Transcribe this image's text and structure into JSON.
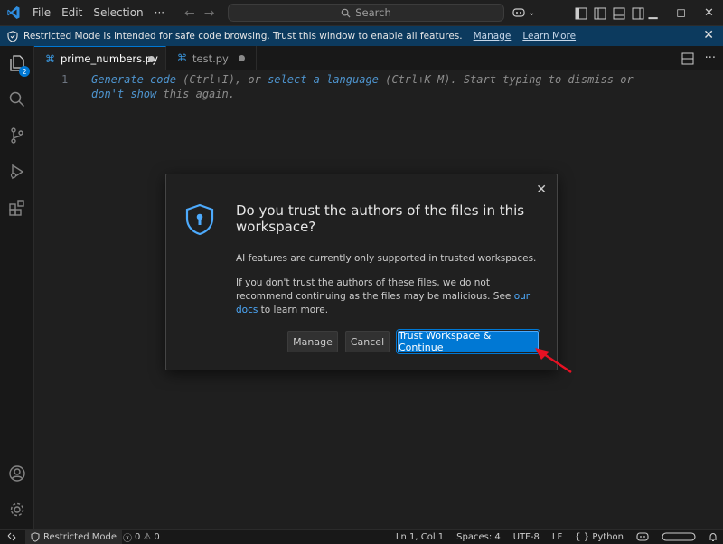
{
  "menu": {
    "file": "File",
    "edit": "Edit",
    "selection": "Selection",
    "more": "···"
  },
  "search": {
    "label": "Search"
  },
  "banner": {
    "message": "Restricted Mode is intended for safe code browsing. Trust this window to enable all features.",
    "manage_link": "Manage",
    "learn_more_link": "Learn More"
  },
  "activity": {
    "source_control_badge": "2"
  },
  "tabs": [
    {
      "label": "prime_numbers.py",
      "active": true,
      "dirty": true
    },
    {
      "label": "test.py",
      "active": false,
      "dirty": true
    }
  ],
  "editor": {
    "line_number": "1",
    "hint": {
      "generate": "Generate code",
      "generate_key": " (Ctrl+I), or ",
      "select_language": "select a language",
      "select_key": " (Ctrl+K M). Start typing to dismiss or",
      "dont_show": "don't show",
      "tail": " this again."
    }
  },
  "dialog": {
    "title": "Do you trust the authors of the files in this workspace?",
    "line1": "AI features are currently only supported in trusted workspaces.",
    "line2_pre": "If you don't trust the authors of these files, we do not recommend continuing as the files may be malicious. See ",
    "line2_link": "our docs",
    "line2_post": " to learn more.",
    "manage_button": "Manage",
    "cancel_button": "Cancel",
    "trust_button": "Trust Workspace & Continue"
  },
  "statusbar": {
    "restricted_mode": "Restricted Mode",
    "errors": "0",
    "warnings": "0",
    "position": "Ln 1, Col 1",
    "spaces": "Spaces: 4",
    "encoding": "UTF-8",
    "eol": "LF",
    "language_braces": "{ }",
    "language": "Python"
  },
  "colors": {
    "accent": "#0078d4",
    "banner_bg": "#0c3a5e",
    "pointer_arrow": "#e81123"
  }
}
